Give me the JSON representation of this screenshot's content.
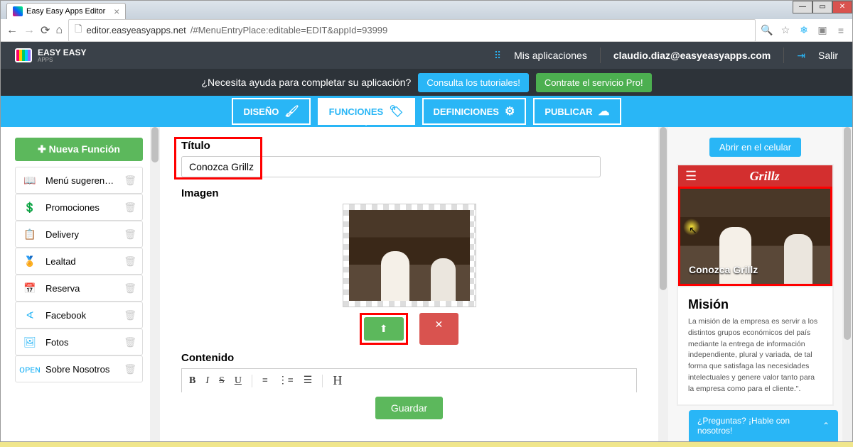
{
  "browser": {
    "tab_title": "Easy Easy Apps Editor",
    "url_host": "editor.easyeasyapps.net",
    "url_path": "/#MenuEntryPlace:editable=EDIT&appId=93999"
  },
  "topbar": {
    "brand": "EASY EASY",
    "brand_sub": "APPS",
    "my_apps": "Mis aplicaciones",
    "email": "claudio.diaz@easyeasyapps.com",
    "logout": "Salir"
  },
  "helpbar": {
    "question": "¿Necesita ayuda para completar su aplicación?",
    "tutorials": "Consulta los tutoriales!",
    "pro": "Contrate el servicio Pro!"
  },
  "navbar": {
    "design": "DISEÑO",
    "functions": "FUNCIONES",
    "definitions": "DEFINICIONES",
    "publish": "PUBLICAR"
  },
  "sidebar": {
    "new_function": "Nueva Función",
    "items": [
      {
        "label": "Menú sugerenci...",
        "icon": "📖"
      },
      {
        "label": "Promociones",
        "icon": "💲"
      },
      {
        "label": "Delivery",
        "icon": "📋"
      },
      {
        "label": "Lealtad",
        "icon": "🏅"
      },
      {
        "label": "Reserva",
        "icon": "📅"
      },
      {
        "label": "Facebook",
        "icon": "∢"
      },
      {
        "label": "Fotos",
        "icon": "🖼"
      },
      {
        "label": "Sobre Nosotros",
        "icon": "ᴏᴘᴇɴ"
      }
    ]
  },
  "editor": {
    "title_label": "Título",
    "title_value": "Conozca Grillz",
    "image_label": "Imagen",
    "content_label": "Contenido",
    "save": "Guardar"
  },
  "preview": {
    "open_phone": "Abrir en el celular",
    "brand": "Grillz",
    "hero_title": "Conozca Grillz",
    "card_title": "Misión",
    "card_text": "La misión de la empresa es servir a los distintos grupos económicos del país mediante la entrega de información independiente, plural y variada, de tal forma que satisfaga las necesidades intelectuales y genere valor tanto para la empresa como para el cliente.\"."
  },
  "chat": {
    "text": "¿Preguntas? ¡Hable con nosotros!"
  }
}
